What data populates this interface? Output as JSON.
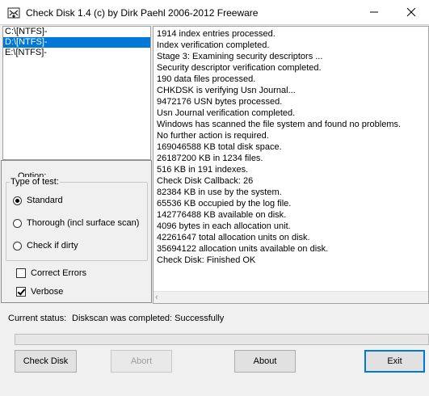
{
  "window": {
    "title": "Check Disk 1.4  (c) by Dirk Paehl  2006-2012 Freeware",
    "minimize_icon": "minimize-icon",
    "close_icon": "close-icon"
  },
  "drives": [
    {
      "label": "C:\\[NTFS]-",
      "selected": false
    },
    {
      "label": "D:\\[NTFS]-",
      "selected": true
    },
    {
      "label": "E:\\[NTFS]-",
      "selected": false
    }
  ],
  "options": {
    "title": "Option:",
    "type_of_test_label": "Type of test:",
    "tests": [
      {
        "label": "Standard",
        "checked": true
      },
      {
        "label": "Thorough (incl surface scan)",
        "checked": false
      },
      {
        "label": "Check if dirty",
        "checked": false
      }
    ],
    "correct_errors": {
      "label": "Correct Errors",
      "checked": false
    },
    "verbose": {
      "label": "Verbose",
      "checked": true
    }
  },
  "log": [
    "1914 index entries processed.",
    "Index verification completed.",
    "Stage 3: Examining security descriptors ...",
    "Security descriptor verification completed.",
    "190 data files processed.",
    "CHKDSK is verifying Usn Journal...",
    "9472176 USN bytes processed.",
    "Usn Journal verification completed.",
    "Windows has scanned the file system and found no problems.",
    "No further action is required.",
    "169046588 KB total disk space.",
    "26187200 KB in 1234 files.",
    "516 KB in 191 indexes.",
    "Check Disk Callback: 26",
    "82384 KB in use by the system.",
    "65536 KB occupied by the log file.",
    "142776488 KB available on disk.",
    "4096 bytes in each allocation unit.",
    "42261647 total allocation units on disk.",
    "35694122 allocation units available on disk.",
    "Check Disk: Finished OK"
  ],
  "status": {
    "label": "Current status:",
    "value": "Diskscan was completed: Successfully"
  },
  "progress": {
    "value": 0
  },
  "buttons": {
    "check_disk": "Check Disk",
    "abort": "Abort",
    "about": "About",
    "exit": "Exit"
  },
  "colors": {
    "selection": "#0078d7",
    "window_bg": "#f0f0f0"
  }
}
